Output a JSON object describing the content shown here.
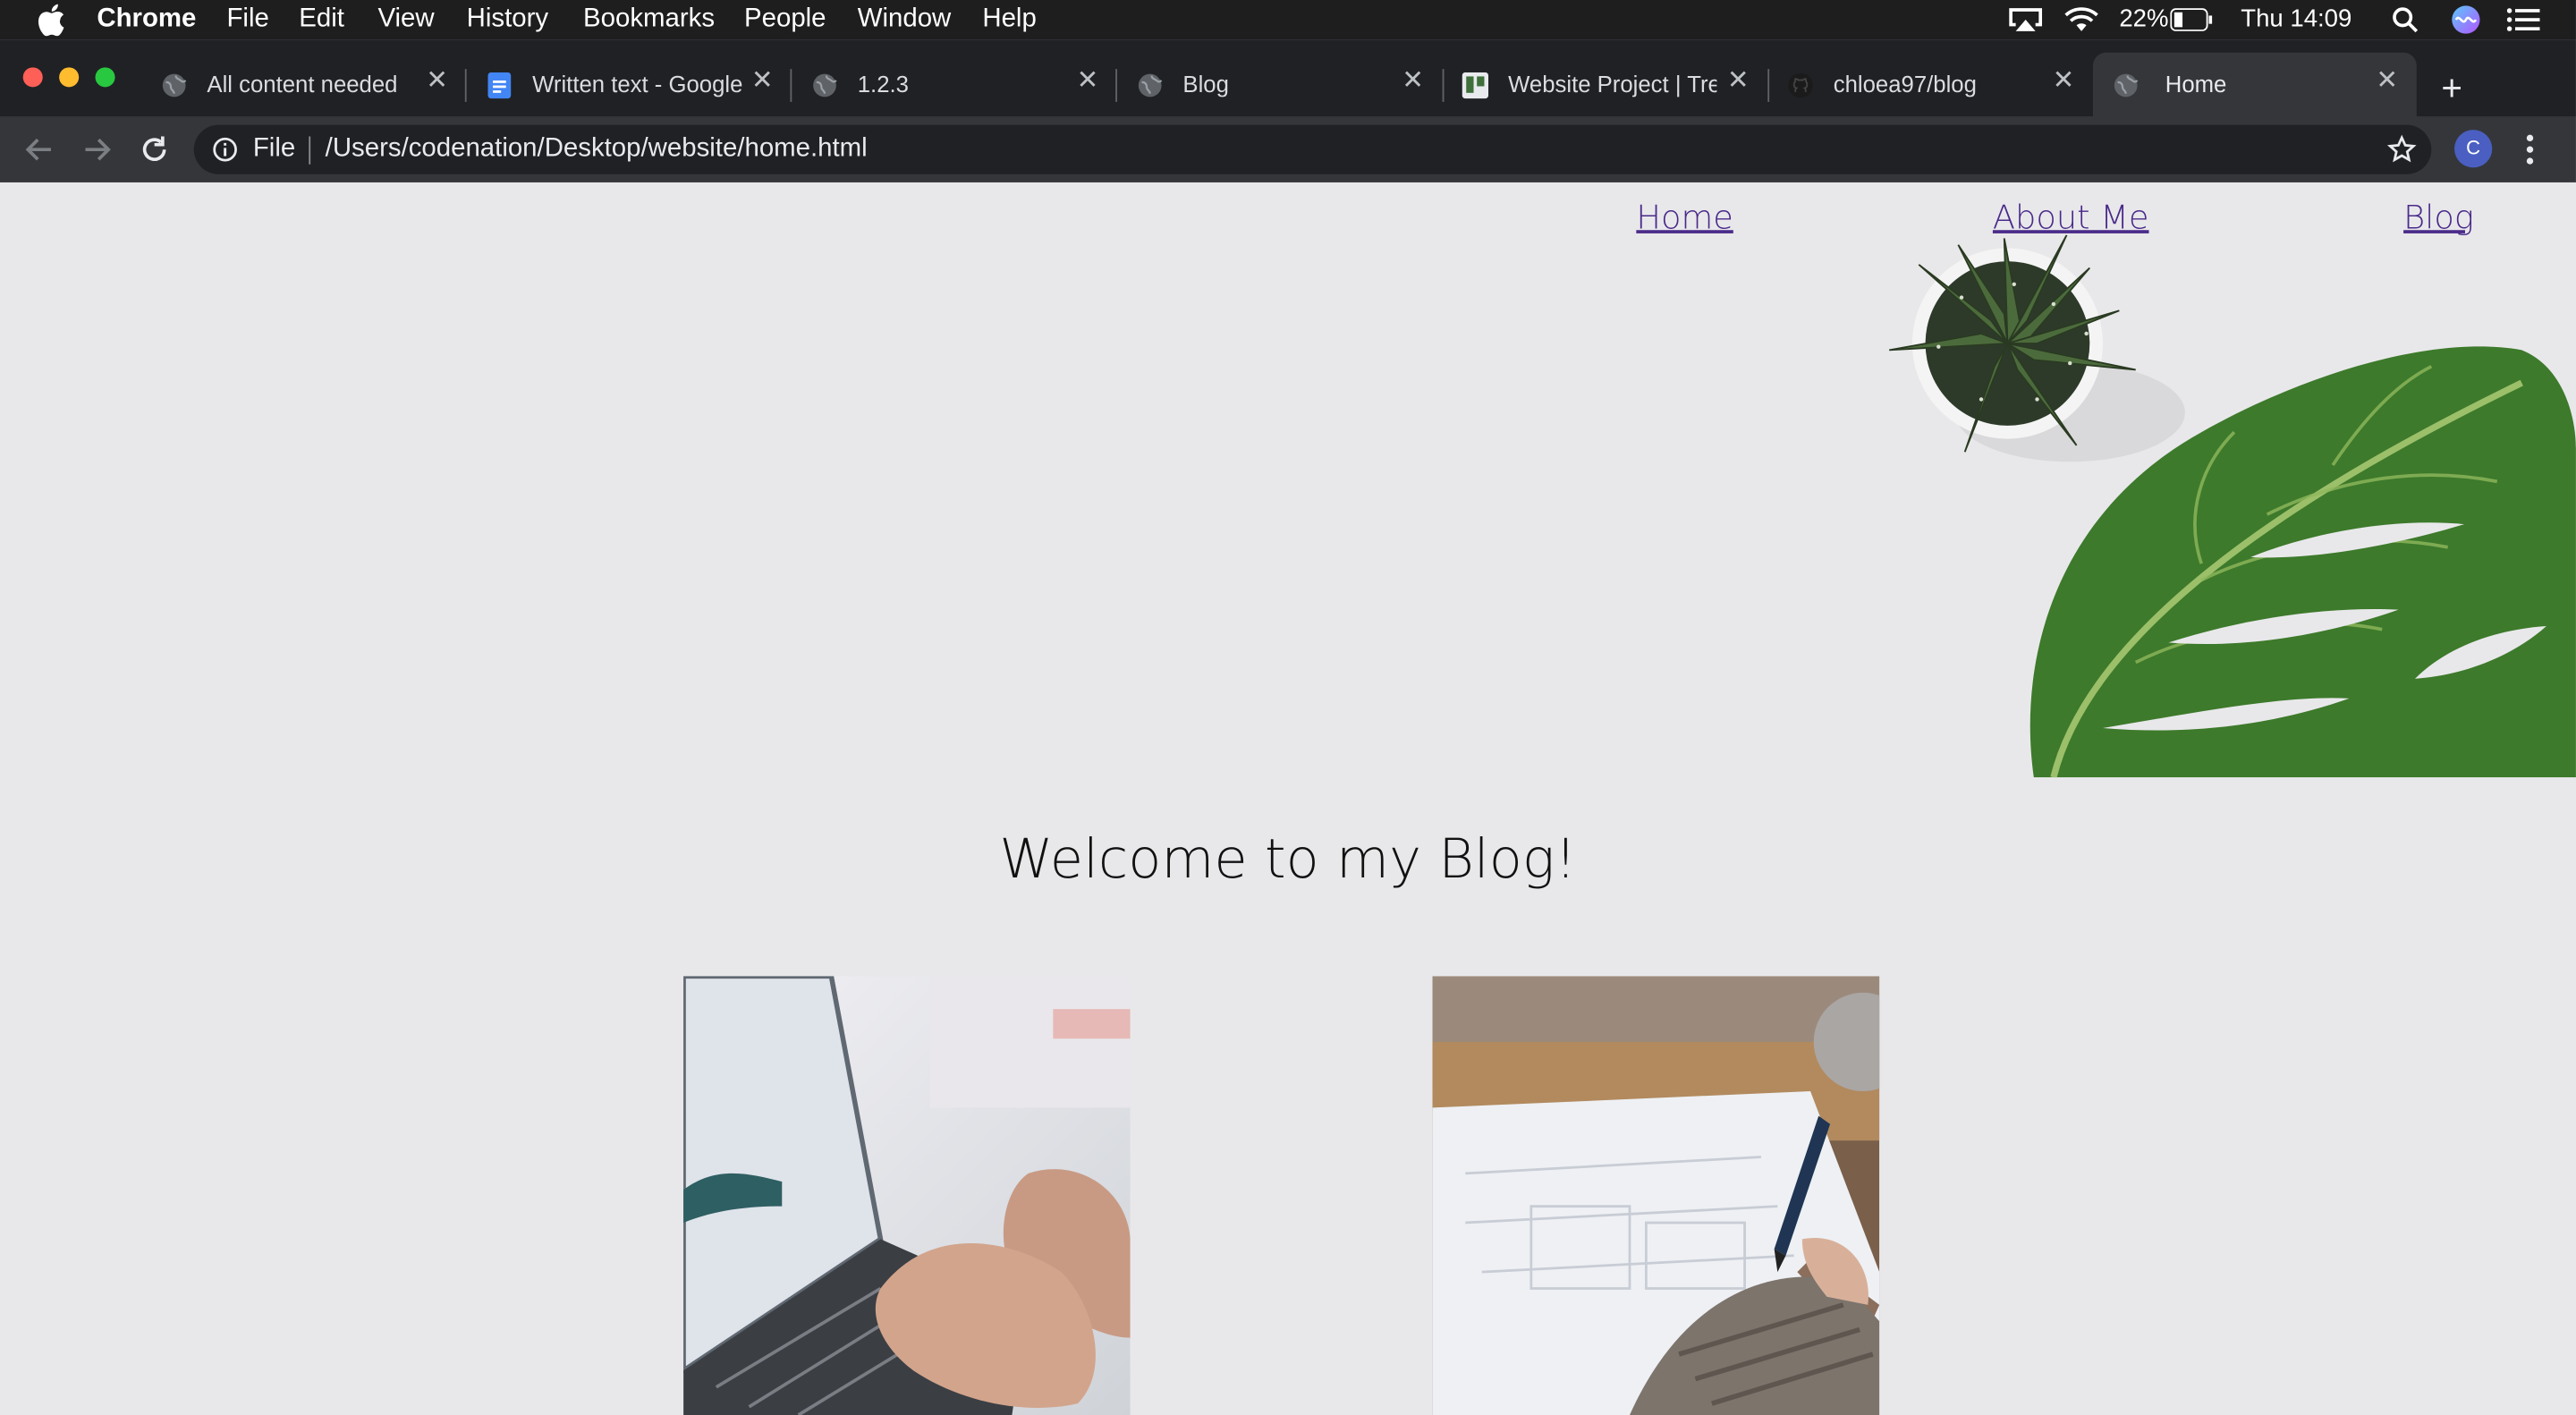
{
  "menubar": {
    "app": "Chrome",
    "items": [
      "File",
      "Edit",
      "View",
      "History",
      "Bookmarks",
      "People",
      "Window",
      "Help"
    ],
    "battery": "22%",
    "clock": "Thu 14:09"
  },
  "tabs": [
    {
      "title": "All content needed",
      "icon": "globe-icon"
    },
    {
      "title": "Written text - Google",
      "icon": "docs-icon"
    },
    {
      "title": "1.2.3",
      "icon": "globe-icon"
    },
    {
      "title": "Blog",
      "icon": "globe-icon"
    },
    {
      "title": "Website Project | Tre",
      "icon": "trello-icon"
    },
    {
      "title": "chloea97/blog",
      "icon": "github-icon"
    },
    {
      "title": "Home",
      "icon": "globe-icon",
      "active": true
    }
  ],
  "toolbar": {
    "scheme": "File",
    "url": "/Users/codenation/Desktop/website/home.html",
    "profile_initial": "C"
  },
  "page": {
    "nav": [
      "Home",
      "About Me",
      "Blog"
    ],
    "heading": "Welcome to my Blog!",
    "link_color": "#4a2a8a",
    "background": "#e8e8ea"
  }
}
